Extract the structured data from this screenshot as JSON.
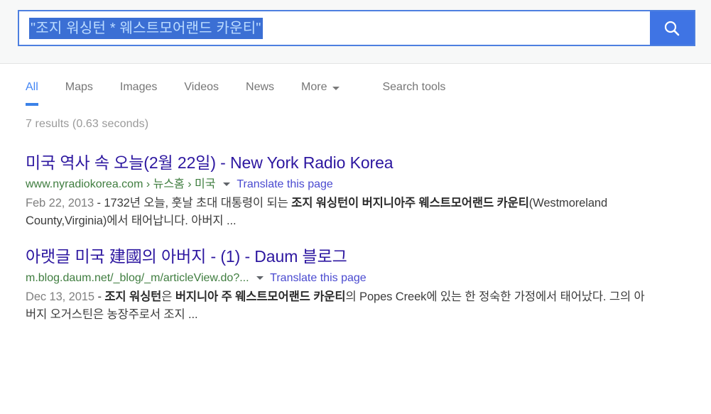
{
  "search": {
    "query_text": "\"조지 워싱턴 * 웨스트모어랜드 카운티\"",
    "placeholder": "Search",
    "button_icon": "search-icon",
    "selected": true,
    "accent_color": "#3f74e4",
    "selection_color": "#3b6fd4"
  },
  "nav": {
    "tabs": [
      {
        "label": "All",
        "active": true
      },
      {
        "label": "Maps",
        "active": false
      },
      {
        "label": "Images",
        "active": false
      },
      {
        "label": "Videos",
        "active": false
      },
      {
        "label": "News",
        "active": false
      },
      {
        "label": "More",
        "active": false,
        "caret": true
      },
      {
        "label": "Search tools",
        "active": false
      }
    ],
    "active_color": "#4285f4"
  },
  "stats": {
    "text": "7 results (0.63 seconds)"
  },
  "results": [
    {
      "title": "미국 역사 속 오늘(2월 22일) - New York Radio Korea",
      "url": "www.nyradiokorea.com › 뉴스홈 › 미국",
      "translate": "Translate this page",
      "snippet_date": "Feb 22, 2013",
      "snippet_parts": [
        {
          "text": " - 1732년 오늘, 훗날 초대 대통령이 되는 ",
          "bold": false
        },
        {
          "text": "조지 워싱턴이 버지니아주 웨스트모어랜드 카운티",
          "bold": true
        },
        {
          "text": "(Westmoreland County,Virginia)에서 태어납니다. 아버지 ...",
          "bold": false
        }
      ]
    },
    {
      "title": "아랫글 미국 建國의 아버지 - (1) - Daum 블로그",
      "url": "m.blog.daum.net/_blog/_m/articleView.do?...",
      "translate": "Translate this page",
      "snippet_date": "Dec 13, 2015",
      "snippet_parts": [
        {
          "text": " - ",
          "bold": false
        },
        {
          "text": "조지 워싱턴",
          "bold": true
        },
        {
          "text": "은 ",
          "bold": false
        },
        {
          "text": "버지니아 주 웨스트모어랜드 카운티",
          "bold": true
        },
        {
          "text": "의 Popes Creek에 있는 한 정숙한 가정에서 태어났다. 그의 아버지 오거스틴은 농장주로서 조지 ...",
          "bold": false
        }
      ]
    }
  ]
}
